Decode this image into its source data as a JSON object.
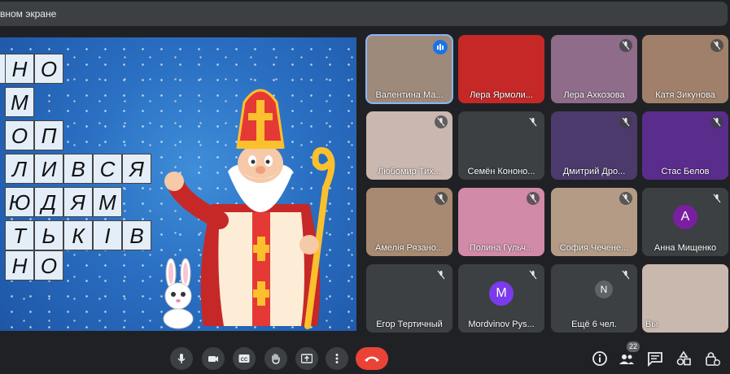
{
  "presentation_banner": {
    "text": "вном экране"
  },
  "crossword": {
    "rows": [
      [
        "Н",
        "О"
      ],
      [
        "М"
      ],
      [
        "О",
        "П"
      ],
      [
        "Л",
        "И",
        "В",
        "С",
        "Я"
      ],
      [
        "Ю",
        "Д",
        "Я",
        "М"
      ],
      [
        "Т",
        "Ь",
        "К",
        "І",
        "В"
      ],
      [
        "Н",
        "О"
      ]
    ]
  },
  "participants": [
    {
      "name": "Валентина Ма...",
      "speaking": true,
      "color": "#9e8a7a"
    },
    {
      "name": "Лера Ярмоли...",
      "color": "#c62828"
    },
    {
      "name": "Лера Ахкозова",
      "color": "#8e6c8a"
    },
    {
      "name": "Катя Зикунова",
      "color": "#a0806a"
    },
    {
      "name": "Любомир Тих...",
      "color": "#c9b7b0"
    },
    {
      "name": "Семён Кононо...",
      "color": "#3c4043"
    },
    {
      "name": "Дмитрий Дро...",
      "color": "#4b3a6b"
    },
    {
      "name": "Стас Белов",
      "color": "#5a2d8c"
    },
    {
      "name": "Амелія Рязано...",
      "color": "#a88a72"
    },
    {
      "name": "Полина Гульч...",
      "color": "#d18aa7"
    },
    {
      "name": "София Чечене...",
      "color": "#b39b86"
    },
    {
      "name": "Анна Мищенко",
      "avatar": "A",
      "avatar_color": "#7b1fa2"
    },
    {
      "name": "Егор Тертичный",
      "color": "#3c4043"
    },
    {
      "name": "Mordvinov Pys...",
      "avatar": "M",
      "avatar_color": "#7c3aed"
    },
    {
      "name": "Ещё 6 чел.",
      "color": "#3c4043",
      "avatar": "N",
      "avatar_color": "#5f6368"
    },
    {
      "name": "Вы",
      "color": "#c8b8ad"
    }
  ],
  "controls": {
    "people_count": "22",
    "captions_label": "CC"
  },
  "colors": {
    "accent": "#8ab4f8",
    "end_call": "#ea4335",
    "panel": "#3c4043"
  }
}
